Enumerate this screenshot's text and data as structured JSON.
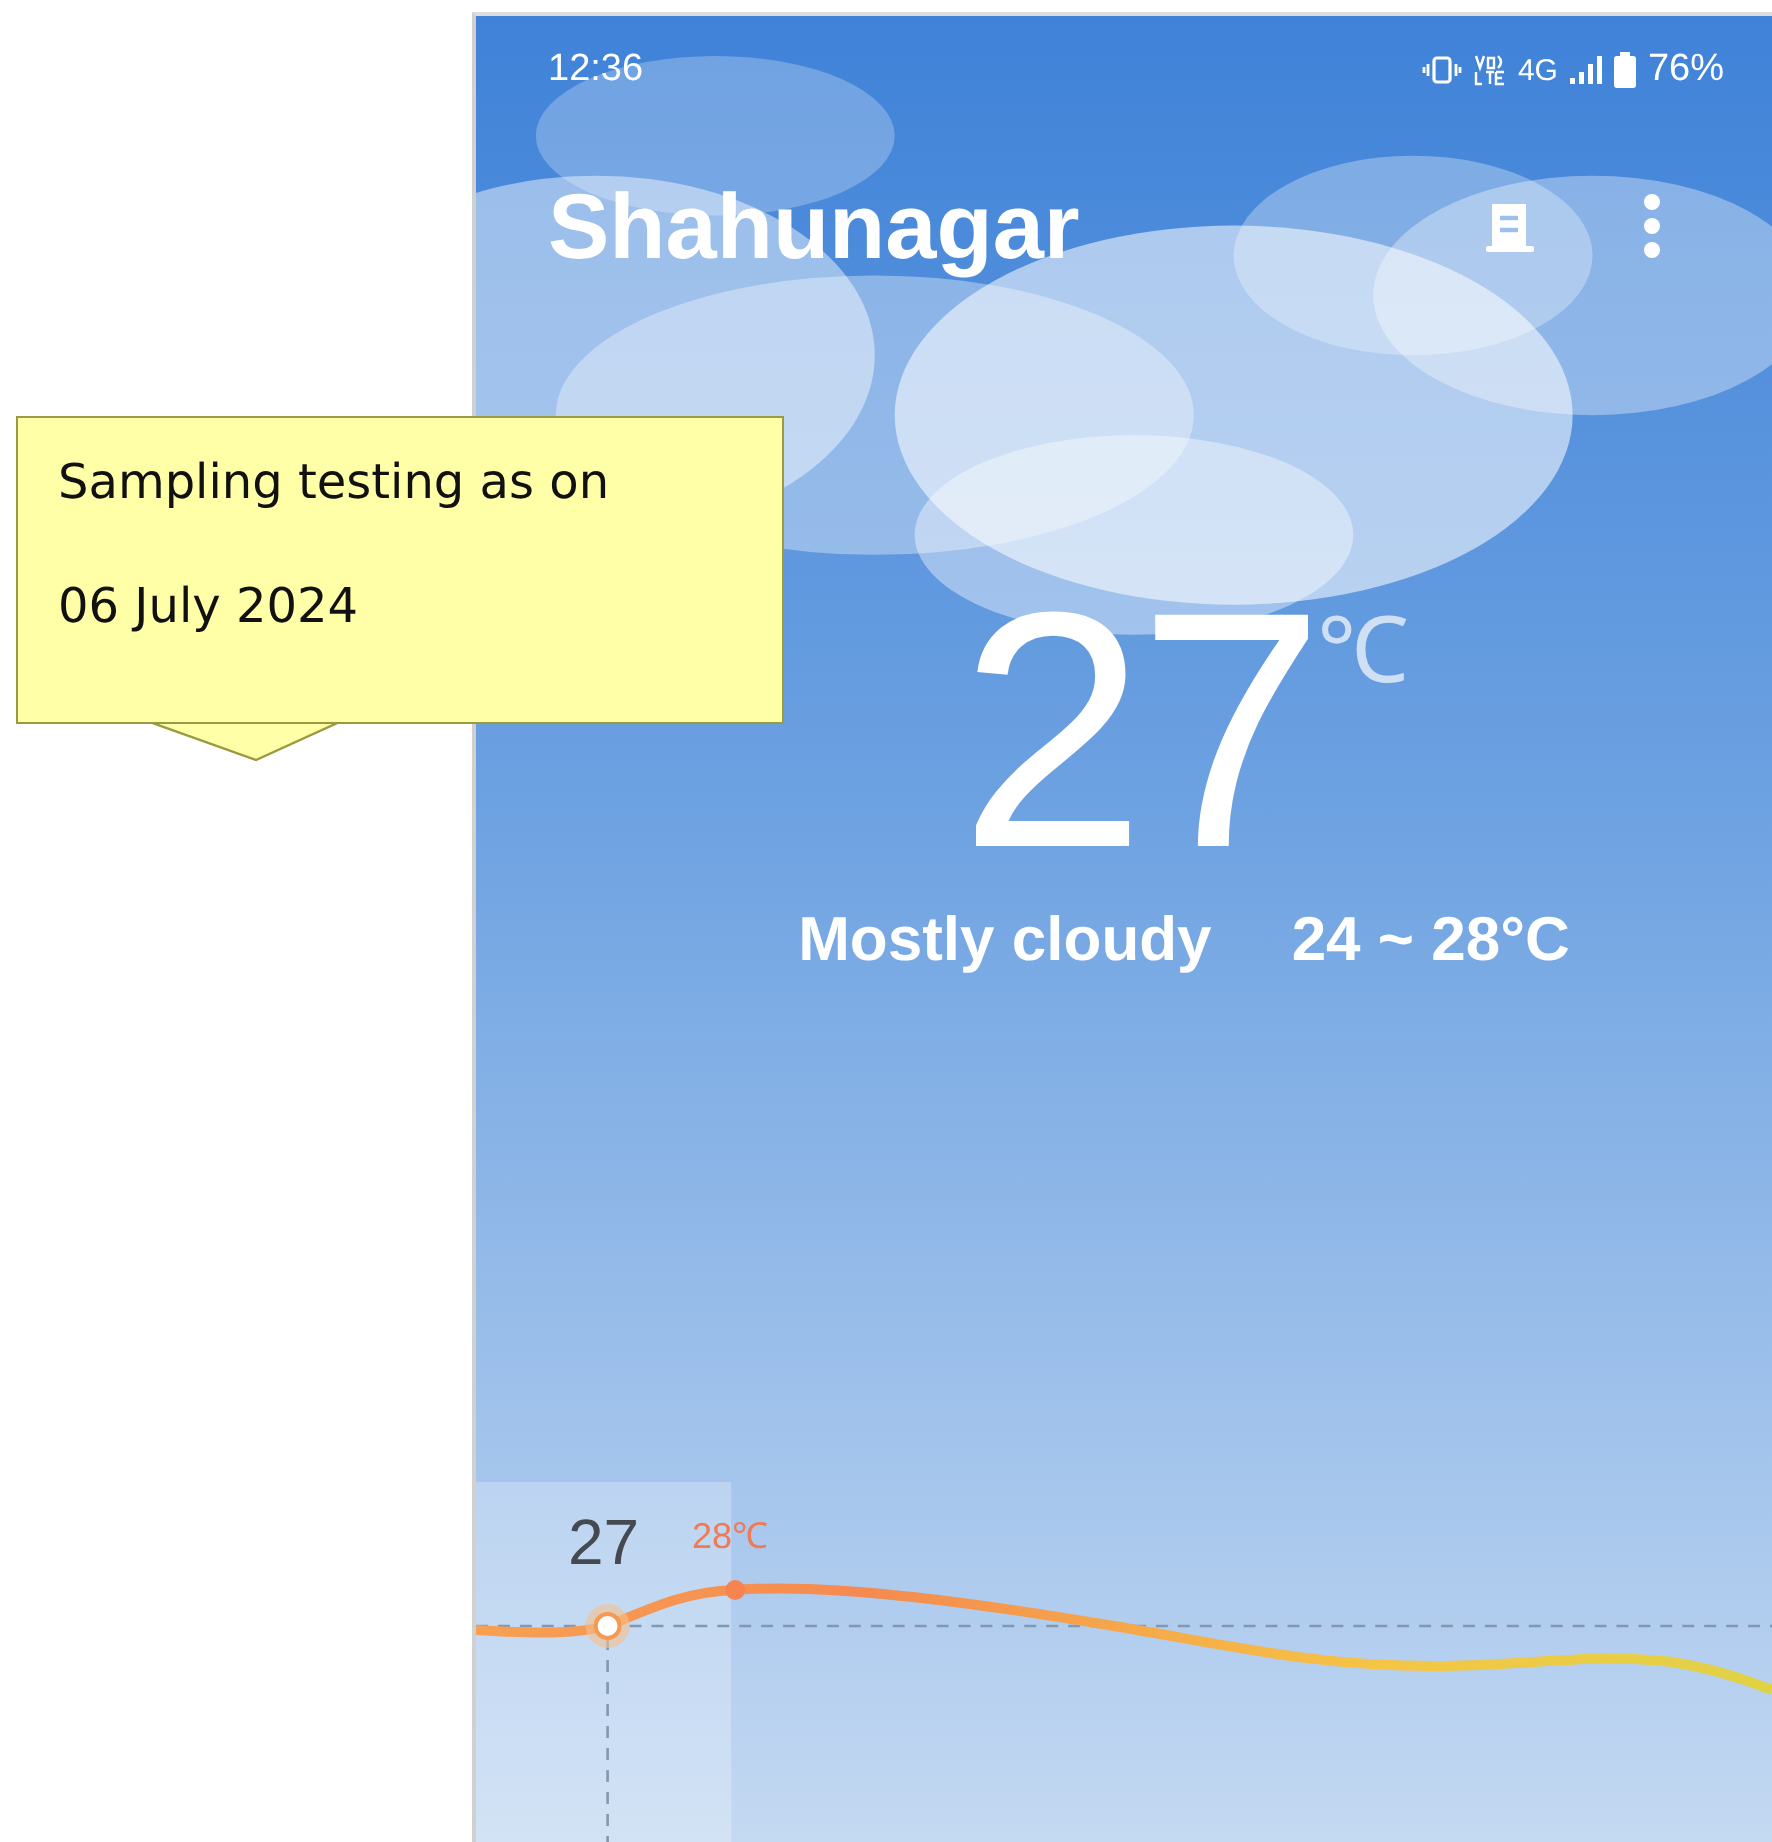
{
  "status_bar": {
    "time": "12:36",
    "network": "4G",
    "battery": "76%"
  },
  "header": {
    "city": "Shahunagar"
  },
  "current": {
    "temperature": "27",
    "unit": "℃",
    "condition": "Mostly cloudy",
    "range": "24 ~ 28°C"
  },
  "hourly": {
    "current_label": "27",
    "high_label": "28℃"
  },
  "callout": {
    "lines": [
      "Sampling testing as on",
      "06 July 2024"
    ]
  }
}
